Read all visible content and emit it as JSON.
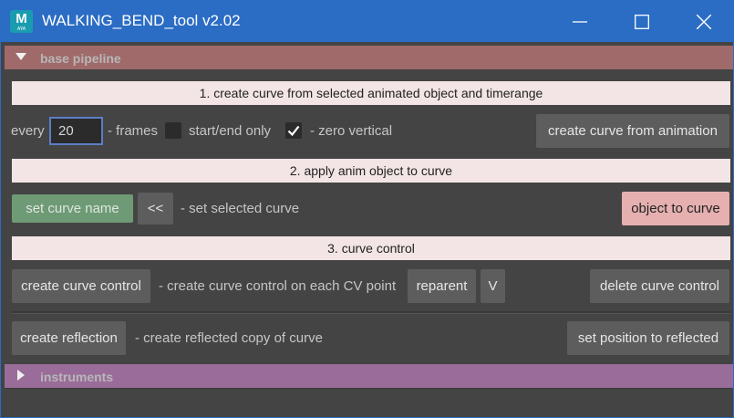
{
  "window": {
    "title": "WALKING_BEND_tool v2.02",
    "icon_letter": "M",
    "icon_sub": "AYA",
    "accent": "#2b6cc4"
  },
  "sections": {
    "pipeline": {
      "label": "base pipeline",
      "expanded": true,
      "color": "#a06a6a"
    },
    "instruments": {
      "label": "instruments",
      "expanded": false,
      "color": "#9a6c9a"
    }
  },
  "step1": {
    "banner": "1. create curve from selected animated object and timerange",
    "every_label": "every",
    "every_value": "20",
    "frames_label": "- frames",
    "start_end_label": "start/end only",
    "start_end_checked": false,
    "zero_vertical_label": "- zero vertical",
    "zero_vertical_checked": true,
    "create_button": "create curve from animation"
  },
  "step2": {
    "banner": "2. apply anim object to curve",
    "set_curve_name_button": "set curve name",
    "arrow_button": "<<",
    "selected_curve_label": "- set selected curve",
    "object_to_curve_button": "object to curve"
  },
  "step3": {
    "banner": "3. curve control",
    "create_control_button": "create curve control",
    "control_desc": "- create curve control on each CV point",
    "reparent_button": "reparent",
    "v_button": "V",
    "delete_control_button": "delete curve control",
    "create_reflection_button": "create reflection",
    "reflection_desc": "- create reflected copy of curve",
    "set_position_button": "set position to reflected"
  },
  "icons": [
    "app-icon",
    "minimize-icon",
    "maximize-icon",
    "close-icon",
    "triangle-down-icon",
    "triangle-right-icon",
    "checkmark-icon"
  ]
}
